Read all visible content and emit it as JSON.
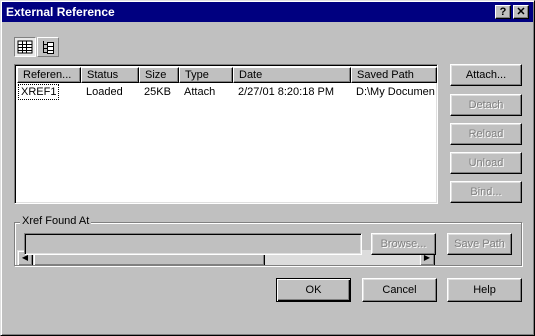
{
  "window": {
    "title": "External Reference",
    "help_glyph": "?",
    "close_glyph": "✕"
  },
  "toolbar": {
    "list_view_icon": "list-view-icon",
    "tree_view_icon": "tree-view-icon"
  },
  "list": {
    "columns": [
      "Referen...",
      "Status",
      "Size",
      "Type",
      "Date",
      "Saved Path"
    ],
    "rows": [
      [
        "XREF1",
        "Loaded",
        "25KB",
        "Attach",
        "2/27/01 8:20:18 PM",
        "D:\\My Documen"
      ]
    ]
  },
  "buttons": {
    "attach": "Attach...",
    "detach": "Detach",
    "reload": "Reload",
    "unload": "Unload",
    "bind": "Bind...",
    "browse": "Browse...",
    "save_path": "Save Path",
    "ok": "OK",
    "cancel": "Cancel",
    "help": "Help"
  },
  "found_at": {
    "label": "Xref Found At",
    "value": ""
  }
}
